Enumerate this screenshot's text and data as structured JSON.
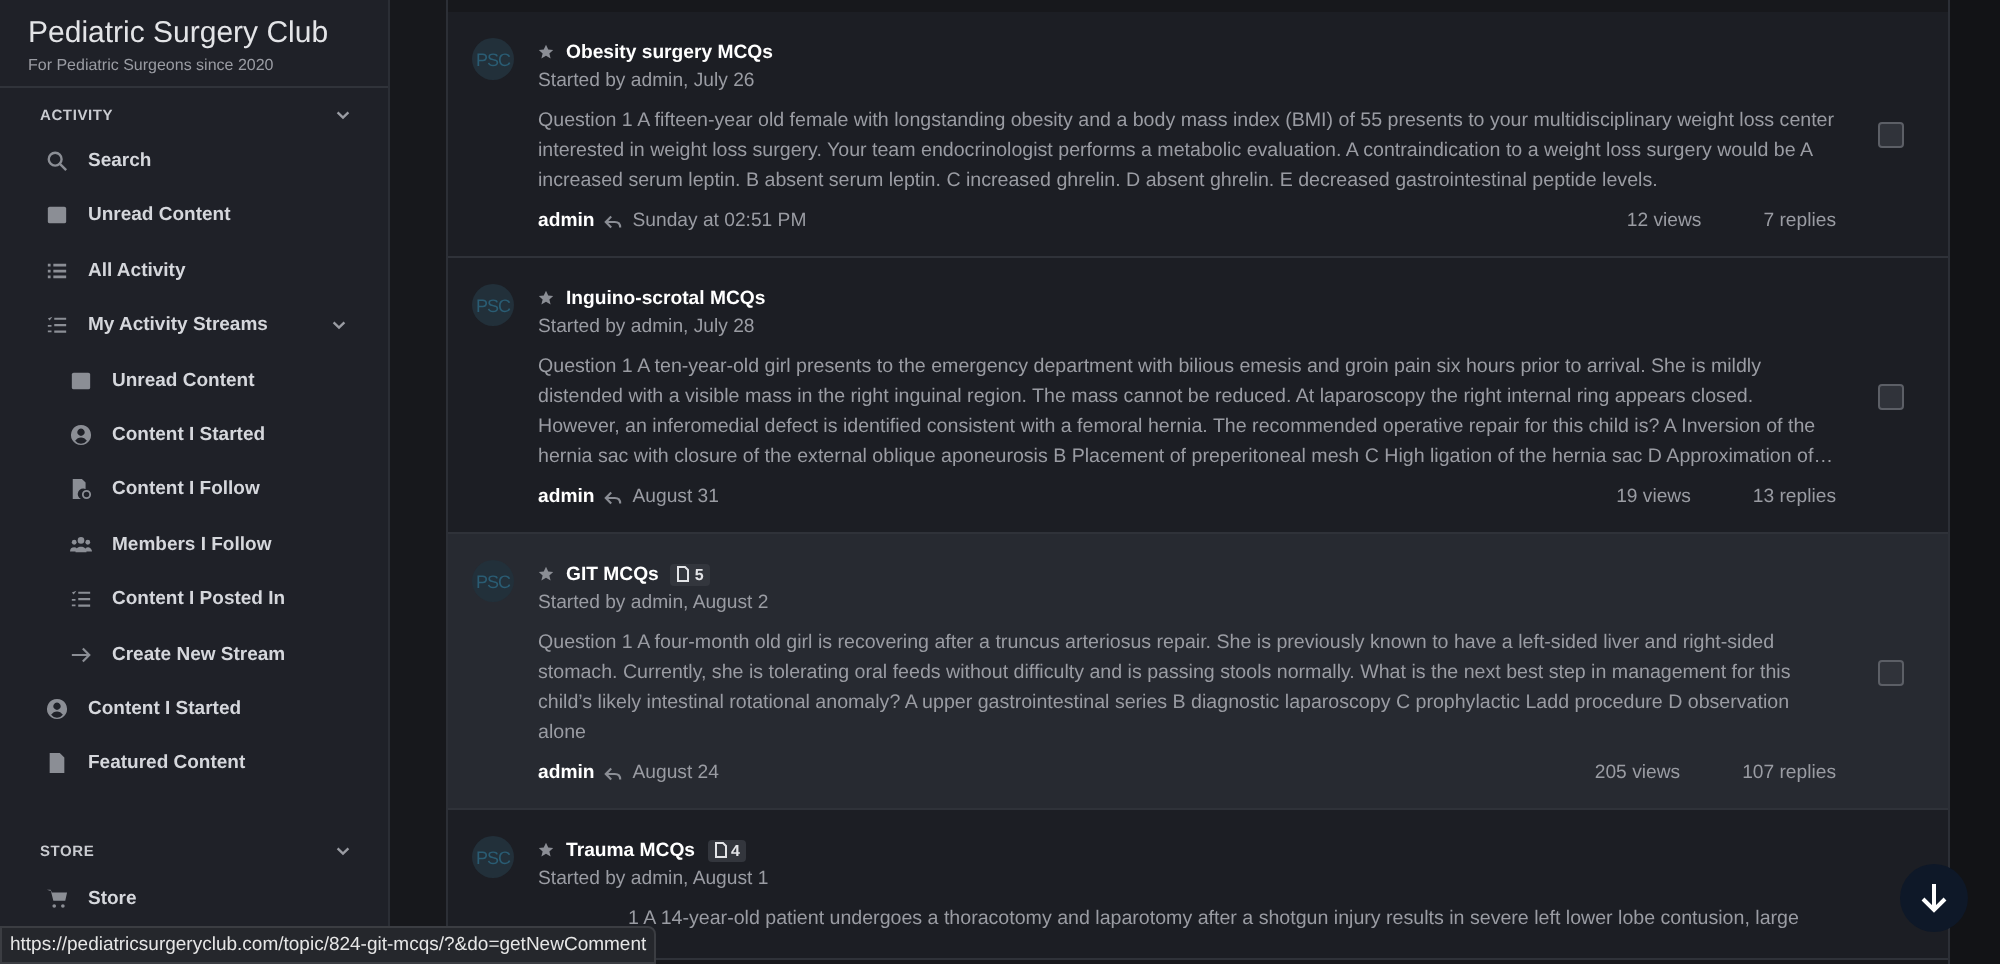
{
  "sidebar": {
    "title": "Pediatric Surgery Club",
    "subtitle": "For Pediatric Surgeons since 2020",
    "sections": [
      {
        "heading": "ACTIVITY",
        "expanded": true,
        "items": [
          {
            "label": "Search",
            "kind": "search"
          },
          {
            "label": "Unread Content",
            "kind": "unread"
          },
          {
            "label": "All Activity",
            "kind": "activity"
          },
          {
            "label": "My Activity Streams",
            "kind": "streams",
            "expanded": true,
            "children": [
              {
                "label": "Unread Content",
                "kind": "unread"
              },
              {
                "label": "Content I Started",
                "kind": "started"
              },
              {
                "label": "Content I Follow",
                "kind": "follow"
              },
              {
                "label": "Members I Follow",
                "kind": "members"
              },
              {
                "label": "Content I Posted In",
                "kind": "streams"
              },
              {
                "label": "Create New Stream",
                "kind": "create"
              }
            ]
          },
          {
            "label": "Content I Started",
            "kind": "started"
          },
          {
            "label": "Featured Content",
            "kind": "featured"
          }
        ]
      },
      {
        "heading": "STORE",
        "expanded": true,
        "items": [
          {
            "label": "Store",
            "kind": "store"
          }
        ]
      }
    ]
  },
  "topics": [
    {
      "avatar": "PSC",
      "title": "Obesity surgery MCQs",
      "started": "Started by admin, July 26",
      "excerpt": "Question 1 A fifteen-year old female with longstanding obesity and a body mass index (BMI) of 55 presents to your multidisciplinary weight loss center interested in weight loss surgery. Your team endocrinologist performs a metabolic evaluation. A contraindication to a weight loss surgery would be A increased serum leptin. B absent serum leptin. C increased ghrelin. D absent ghrelin. E decreased gastrointestinal peptide levels.",
      "last_poster": "admin",
      "last_date": "Sunday at 02:51 PM",
      "views": "12 views",
      "replies": "7 replies",
      "highlighted": false,
      "checked": false
    },
    {
      "avatar": "PSC",
      "title": "Inguino-scrotal MCQs",
      "started": "Started by admin, July 28",
      "excerpt": "Question 1 A ten-year-old girl presents to the emergency department with bilious emesis and groin pain six hours prior to arrival. She is mildly distended with a visible mass in the right inguinal region. The mass cannot be reduced. At laparoscopy the right internal ring appears closed. However, an inferomedial defect is identified consistent with a femoral hernia. The recommended operative repair for this child is? A Inversion of the hernia sac with closure of the external oblique aponeurosis B Placement of preperitoneal mesh C High ligation of the hernia sac D Approximation of…",
      "last_poster": "admin",
      "last_date": "August 31",
      "views": "19 views",
      "replies": "13 replies",
      "highlighted": false,
      "checked": false
    },
    {
      "avatar": "PSC",
      "title": "GIT MCQs",
      "attachments": "5",
      "started": "Started by admin, August 2",
      "excerpt": "Question 1 A four-month old girl is recovering after a truncus arteriosus repair. She is previously known to have a left-sided liver and right-sided stomach. Currently, she is tolerating oral feeds without difficulty and is passing stools normally. What is the next best step in management for this child’s likely intestinal rotational anomaly? A upper gastrointestinal series B diagnostic laparoscopy C prophylactic Ladd procedure D observation alone",
      "last_poster": "admin",
      "last_date": "August 24",
      "views": "205 views",
      "replies": "107 replies",
      "highlighted": true,
      "checked": false
    },
    {
      "avatar": "PSC",
      "title": "Trauma MCQs",
      "attachments": "4",
      "started": "Started by admin, August 1",
      "excerpt": "1 A 14-year-old patient undergoes a thoracotomy and laparotomy after a shotgun injury results in severe left lower lobe contusion, large",
      "highlighted": false
    }
  ],
  "status_url": "https://pediatricsurgeryclub.com/topic/824-git-mcqs/?&do=getNewComment"
}
